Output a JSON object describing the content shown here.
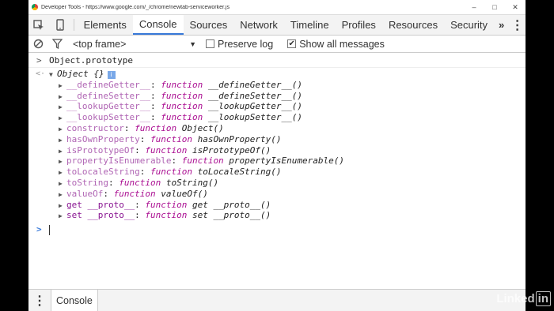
{
  "window": {
    "title": "Developer Tools - https://www.google.com/_/chrome/newtab-serviceworker.js",
    "controls": [
      "–",
      "□",
      "✕"
    ]
  },
  "toolbar": {
    "tabs": [
      "Elements",
      "Console",
      "Sources",
      "Network",
      "Timeline",
      "Profiles",
      "Resources",
      "Security"
    ],
    "active_tab": "Console",
    "more": "»"
  },
  "filter": {
    "context": "<top frame>",
    "context_arrow": "▼",
    "preserve_log": "Preserve log",
    "preserve_log_checked": false,
    "show_all": "Show all messages",
    "show_all_checked": true
  },
  "console": {
    "command": "Object.prototype",
    "object_header": "Object {}",
    "info_badge": "i",
    "properties": [
      {
        "name": "__defineGetter__",
        "value": "function __defineGetter__()",
        "expandable": true,
        "dim": true
      },
      {
        "name": "__defineSetter__",
        "value": "function __defineSetter__()",
        "expandable": true,
        "dim": true
      },
      {
        "name": "__lookupGetter__",
        "value": "function __lookupGetter__()",
        "expandable": true,
        "dim": true
      },
      {
        "name": "__lookupSetter__",
        "value": "function __lookupSetter__()",
        "expandable": true,
        "dim": true
      },
      {
        "name": "constructor",
        "value": "function Object()",
        "expandable": true,
        "dim": true
      },
      {
        "name": "hasOwnProperty",
        "value": "function hasOwnProperty()",
        "expandable": true,
        "dim": true
      },
      {
        "name": "isPrototypeOf",
        "value": "function isPrototypeOf()",
        "expandable": true,
        "dim": true
      },
      {
        "name": "propertyIsEnumerable",
        "value": "function propertyIsEnumerable()",
        "expandable": true,
        "dim": true
      },
      {
        "name": "toLocaleString",
        "value": "function toLocaleString()",
        "expandable": true,
        "dim": true
      },
      {
        "name": "toString",
        "value": "function toString()",
        "expandable": true,
        "dim": true
      },
      {
        "name": "valueOf",
        "value": "function valueOf()",
        "expandable": true,
        "dim": true
      },
      {
        "name": "get __proto__",
        "value": "function get __proto__()",
        "expandable": true,
        "dim": false
      },
      {
        "name": "set __proto__",
        "value": "function set __proto__()",
        "expandable": true,
        "dim": false
      }
    ]
  },
  "drawer": {
    "tab": "Console"
  },
  "watermark": {
    "brand": "Linked",
    "brand_in": "in"
  },
  "colors": {
    "accent": "#3879d9",
    "prop_name": "#881391",
    "keyword": "#aa0d91"
  }
}
